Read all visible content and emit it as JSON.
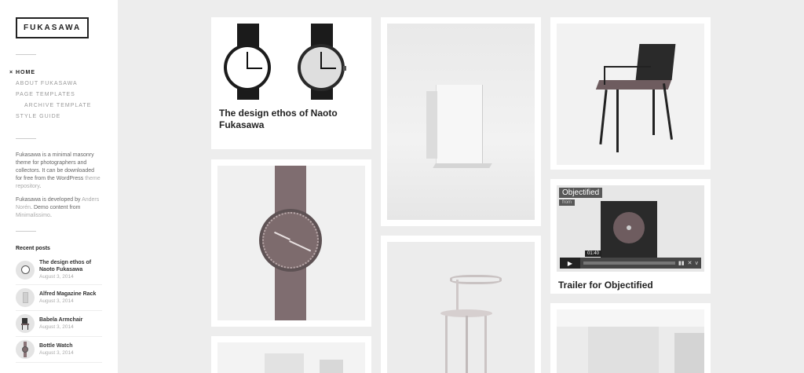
{
  "site": {
    "logo": "FUKASAWA"
  },
  "nav": {
    "bullet": "×",
    "items": [
      {
        "label": "Home",
        "active": true,
        "sub": false
      },
      {
        "label": "About Fukasawa",
        "active": false,
        "sub": false
      },
      {
        "label": "Page Templates",
        "active": false,
        "sub": false
      },
      {
        "label": "Archive Template",
        "active": false,
        "sub": true
      },
      {
        "label": "Style Guide",
        "active": false,
        "sub": false
      }
    ]
  },
  "description": {
    "p1": "Fukasawa is a minimal masonry theme for photographers and collectors. It can be downloaded for free from the WordPress ",
    "p1_link": "theme repository",
    "p1_end": ".",
    "p2_a": "Fukasawa is developed by ",
    "p2_link1": "Anders Norén",
    "p2_b": ". Demo content from ",
    "p2_link2": "Minimalissimo",
    "p2_c": "."
  },
  "recent_posts": {
    "title": "Recent posts",
    "items": [
      {
        "name": "The design ethos of Naoto Fukasawa",
        "date": "August 3, 2014"
      },
      {
        "name": "Alfred Magazine Rack",
        "date": "August 3, 2014"
      },
      {
        "name": "Babela Armchair",
        "date": "August 3, 2014"
      },
      {
        "name": "Bottle Watch",
        "date": "August 3, 2014"
      }
    ]
  },
  "posts": {
    "naoto": {
      "title": "The design ethos of Naoto Fukasawa"
    },
    "objectified": {
      "title": "Trailer for Objectified",
      "video_title": "Objectified",
      "video_from": "from",
      "video_time": "01:40",
      "play_icon": "▶"
    }
  },
  "colors": {
    "background": "#ededed",
    "card": "#ffffff",
    "text": "#222222",
    "accent_watch": "#7d6b6d"
  }
}
